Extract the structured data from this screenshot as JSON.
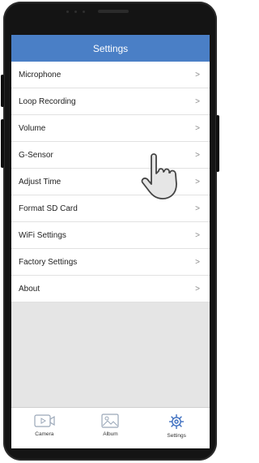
{
  "header": {
    "title": "Settings"
  },
  "settings": {
    "items": [
      {
        "label": "Microphone"
      },
      {
        "label": "Loop Recording"
      },
      {
        "label": "Volume"
      },
      {
        "label": "G-Sensor"
      },
      {
        "label": "Adjust Time"
      },
      {
        "label": "Format SD Card"
      },
      {
        "label": "WiFi Settings"
      },
      {
        "label": "Factory Settings"
      },
      {
        "label": "About"
      }
    ],
    "chevron": ">"
  },
  "tabbar": {
    "tabs": [
      {
        "label": "Camera",
        "icon": "camera-icon"
      },
      {
        "label": "Album",
        "icon": "album-icon"
      },
      {
        "label": "Settings",
        "icon": "gear-icon",
        "active": true
      }
    ]
  },
  "colors": {
    "header": "#4a7fc6",
    "active_icon": "#3d6fc0"
  }
}
